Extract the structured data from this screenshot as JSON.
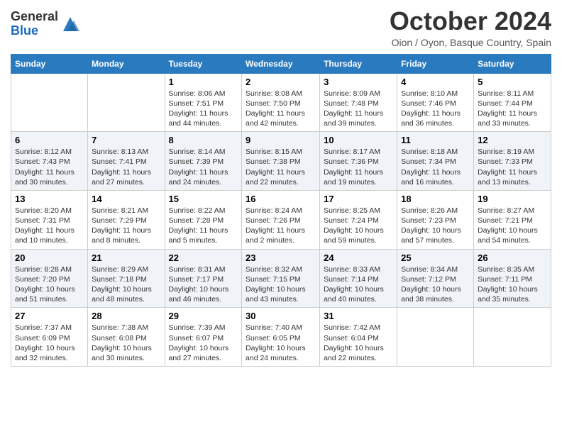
{
  "header": {
    "logo_general": "General",
    "logo_blue": "Blue",
    "month_title": "October 2024",
    "location": "Oion / Oyon, Basque Country, Spain"
  },
  "days_of_week": [
    "Sunday",
    "Monday",
    "Tuesday",
    "Wednesday",
    "Thursday",
    "Friday",
    "Saturday"
  ],
  "weeks": [
    [
      {
        "day": "",
        "info": ""
      },
      {
        "day": "",
        "info": ""
      },
      {
        "day": "1",
        "info": "Sunrise: 8:06 AM\nSunset: 7:51 PM\nDaylight: 11 hours and 44 minutes."
      },
      {
        "day": "2",
        "info": "Sunrise: 8:08 AM\nSunset: 7:50 PM\nDaylight: 11 hours and 42 minutes."
      },
      {
        "day": "3",
        "info": "Sunrise: 8:09 AM\nSunset: 7:48 PM\nDaylight: 11 hours and 39 minutes."
      },
      {
        "day": "4",
        "info": "Sunrise: 8:10 AM\nSunset: 7:46 PM\nDaylight: 11 hours and 36 minutes."
      },
      {
        "day": "5",
        "info": "Sunrise: 8:11 AM\nSunset: 7:44 PM\nDaylight: 11 hours and 33 minutes."
      }
    ],
    [
      {
        "day": "6",
        "info": "Sunrise: 8:12 AM\nSunset: 7:43 PM\nDaylight: 11 hours and 30 minutes."
      },
      {
        "day": "7",
        "info": "Sunrise: 8:13 AM\nSunset: 7:41 PM\nDaylight: 11 hours and 27 minutes."
      },
      {
        "day": "8",
        "info": "Sunrise: 8:14 AM\nSunset: 7:39 PM\nDaylight: 11 hours and 24 minutes."
      },
      {
        "day": "9",
        "info": "Sunrise: 8:15 AM\nSunset: 7:38 PM\nDaylight: 11 hours and 22 minutes."
      },
      {
        "day": "10",
        "info": "Sunrise: 8:17 AM\nSunset: 7:36 PM\nDaylight: 11 hours and 19 minutes."
      },
      {
        "day": "11",
        "info": "Sunrise: 8:18 AM\nSunset: 7:34 PM\nDaylight: 11 hours and 16 minutes."
      },
      {
        "day": "12",
        "info": "Sunrise: 8:19 AM\nSunset: 7:33 PM\nDaylight: 11 hours and 13 minutes."
      }
    ],
    [
      {
        "day": "13",
        "info": "Sunrise: 8:20 AM\nSunset: 7:31 PM\nDaylight: 11 hours and 10 minutes."
      },
      {
        "day": "14",
        "info": "Sunrise: 8:21 AM\nSunset: 7:29 PM\nDaylight: 11 hours and 8 minutes."
      },
      {
        "day": "15",
        "info": "Sunrise: 8:22 AM\nSunset: 7:28 PM\nDaylight: 11 hours and 5 minutes."
      },
      {
        "day": "16",
        "info": "Sunrise: 8:24 AM\nSunset: 7:26 PM\nDaylight: 11 hours and 2 minutes."
      },
      {
        "day": "17",
        "info": "Sunrise: 8:25 AM\nSunset: 7:24 PM\nDaylight: 10 hours and 59 minutes."
      },
      {
        "day": "18",
        "info": "Sunrise: 8:26 AM\nSunset: 7:23 PM\nDaylight: 10 hours and 57 minutes."
      },
      {
        "day": "19",
        "info": "Sunrise: 8:27 AM\nSunset: 7:21 PM\nDaylight: 10 hours and 54 minutes."
      }
    ],
    [
      {
        "day": "20",
        "info": "Sunrise: 8:28 AM\nSunset: 7:20 PM\nDaylight: 10 hours and 51 minutes."
      },
      {
        "day": "21",
        "info": "Sunrise: 8:29 AM\nSunset: 7:18 PM\nDaylight: 10 hours and 48 minutes."
      },
      {
        "day": "22",
        "info": "Sunrise: 8:31 AM\nSunset: 7:17 PM\nDaylight: 10 hours and 46 minutes."
      },
      {
        "day": "23",
        "info": "Sunrise: 8:32 AM\nSunset: 7:15 PM\nDaylight: 10 hours and 43 minutes."
      },
      {
        "day": "24",
        "info": "Sunrise: 8:33 AM\nSunset: 7:14 PM\nDaylight: 10 hours and 40 minutes."
      },
      {
        "day": "25",
        "info": "Sunrise: 8:34 AM\nSunset: 7:12 PM\nDaylight: 10 hours and 38 minutes."
      },
      {
        "day": "26",
        "info": "Sunrise: 8:35 AM\nSunset: 7:11 PM\nDaylight: 10 hours and 35 minutes."
      }
    ],
    [
      {
        "day": "27",
        "info": "Sunrise: 7:37 AM\nSunset: 6:09 PM\nDaylight: 10 hours and 32 minutes."
      },
      {
        "day": "28",
        "info": "Sunrise: 7:38 AM\nSunset: 6:08 PM\nDaylight: 10 hours and 30 minutes."
      },
      {
        "day": "29",
        "info": "Sunrise: 7:39 AM\nSunset: 6:07 PM\nDaylight: 10 hours and 27 minutes."
      },
      {
        "day": "30",
        "info": "Sunrise: 7:40 AM\nSunset: 6:05 PM\nDaylight: 10 hours and 24 minutes."
      },
      {
        "day": "31",
        "info": "Sunrise: 7:42 AM\nSunset: 6:04 PM\nDaylight: 10 hours and 22 minutes."
      },
      {
        "day": "",
        "info": ""
      },
      {
        "day": "",
        "info": ""
      }
    ]
  ]
}
